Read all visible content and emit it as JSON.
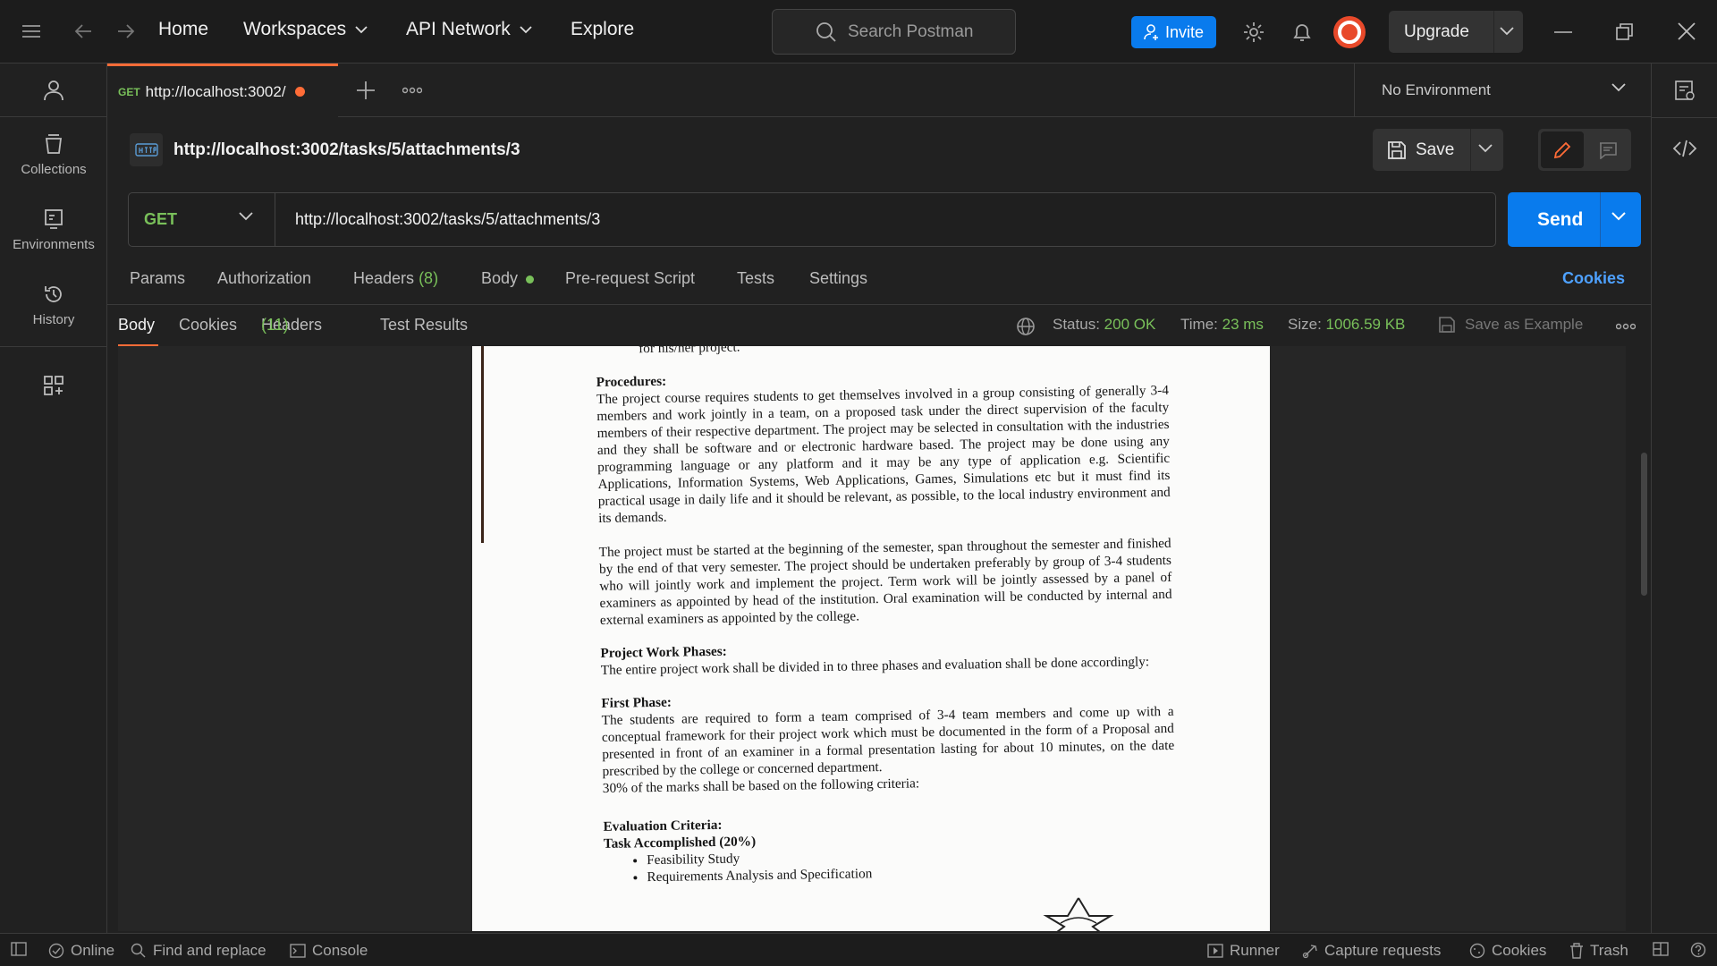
{
  "topbar": {
    "nav": [
      "Home",
      "Workspaces",
      "API Network",
      "Explore"
    ],
    "search_placeholder": "Search Postman",
    "invite": "Invite",
    "upgrade": "Upgrade"
  },
  "sidebar": {
    "items": [
      {
        "label": "Collections",
        "icon": "collections-icon"
      },
      {
        "label": "Environments",
        "icon": "environments-icon"
      },
      {
        "label": "History",
        "icon": "history-icon"
      }
    ]
  },
  "tab": {
    "method": "GET",
    "title": "http://localhost:3002/"
  },
  "environment": "No Environment",
  "request": {
    "title": "http://localhost:3002/tasks/5/attachments/3",
    "save": "Save",
    "method": "GET",
    "url": "http://localhost:3002/tasks/5/attachments/3",
    "send": "Send",
    "tabs": [
      "Params",
      "Authorization",
      "Headers",
      "(8)",
      "Body",
      "Pre-request Script",
      "Tests",
      "Settings"
    ],
    "cookies": "Cookies"
  },
  "response": {
    "tabs": [
      "Body",
      "Cookies",
      "Headers",
      "(11)",
      "Test Results"
    ],
    "status_label": "Status:",
    "status": "200 OK",
    "time_label": "Time:",
    "time": "23 ms",
    "size_label": "Size:",
    "size": "1006.59 KB",
    "save_example": "Save as Example"
  },
  "document": {
    "top_cut": "for his/her project.",
    "procedures_head": "Procedures:",
    "procedures": "The project course requires students to get themselves involved in a group consisting of generally 3-4 members and work jointly in a team, on a proposed task under the direct supervision of the faculty members of their respective department. The project may be selected in consultation with the industries and they shall be software and or electronic hardware based. The project may be done using any programming language or any platform and it may be any type of application e.g. Scientific Applications, Information Systems, Web Applications, Games, Simulations etc but it must find its practical usage in daily life and it should be relevant, as possible, to the local industry environment and its demands.",
    "para2": "The project must be started at the beginning of the semester, span throughout the semester and finished by the end of that very semester. The project should be undertaken preferably by group of 3-4 students who will jointly work and implement the project. Term work will be jointly assessed by a panel of examiners as appointed by head of the institution. Oral examination will be conducted by internal and external examiners as appointed by the college.",
    "phases_head": "Project Work Phases:",
    "phases": "The entire project work shall be divided in to three phases and evaluation shall be done accordingly:",
    "first_head": "First Phase:",
    "first": "The students are required to form a team comprised of 3-4 team members and come up with a conceptual framework for their project work which must be documented in the form of a Proposal and presented in front of an examiner in a formal presentation lasting for about 10 minutes, on the date prescribed by the college or concerned department.",
    "first_marks": "30% of the marks shall be based on the following criteria:",
    "eval_head": "Evaluation Criteria:",
    "task_head": "Task Accomplished (20%)",
    "bullets": [
      "Feasibility Study",
      "Requirements Analysis and Specification"
    ]
  },
  "statusbar": {
    "online": "Online",
    "find": "Find and replace",
    "console": "Console",
    "runner": "Runner",
    "capture": "Capture requests",
    "cookies": "Cookies",
    "trash": "Trash"
  },
  "colors": {
    "accent": "#ff6c37",
    "primary": "#097bed",
    "method_get": "#79c05a"
  }
}
